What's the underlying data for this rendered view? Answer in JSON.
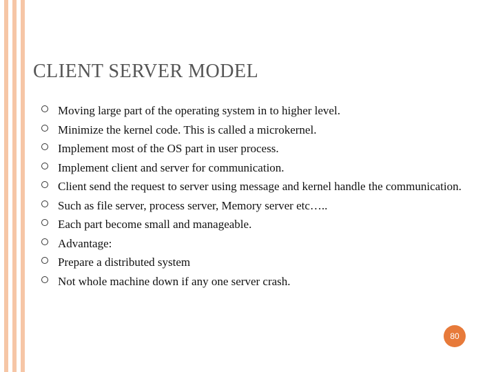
{
  "title": "CLIENT SERVER MODEL",
  "bullets": [
    "Moving large part of the operating system in to higher level.",
    "Minimize the kernel code. This is called a microkernel.",
    "Implement most of the OS part in user process.",
    "Implement client and server for communication.",
    "Client send the request to server using message and kernel handle the communication.",
    "Such as file server, process server, Memory server etc…..",
    "Each part become small and manageable.",
    "Advantage:",
    "Prepare a distributed system",
    "Not whole machine down if any one server crash."
  ],
  "page_number": "80"
}
